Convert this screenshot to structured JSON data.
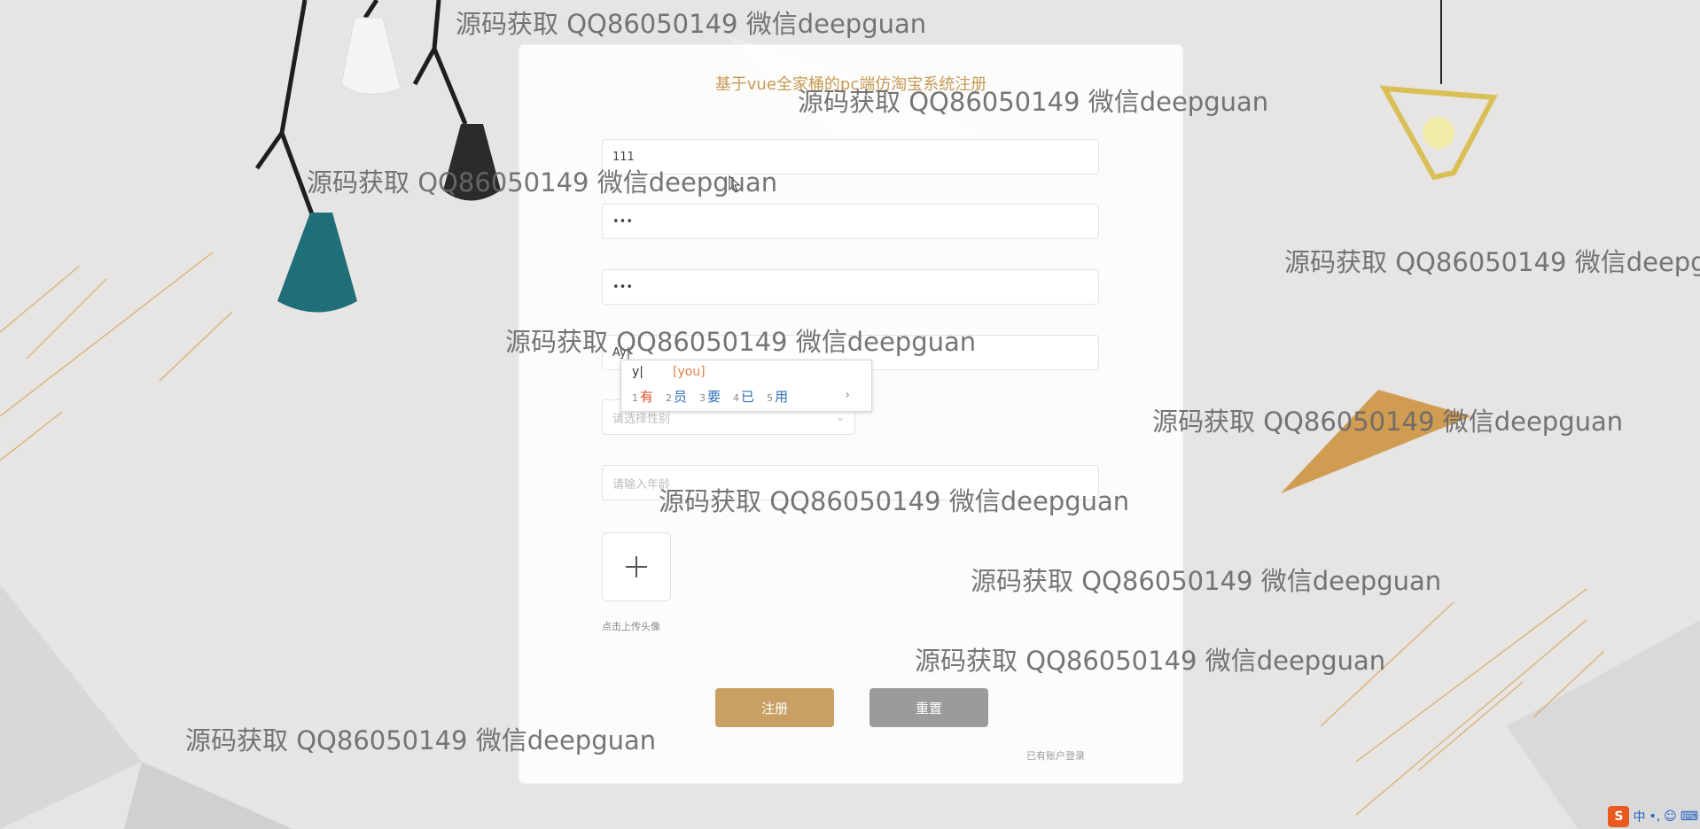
{
  "app": {
    "title": "基于vue全家桶的pc端仿淘宝系统注册"
  },
  "form": {
    "username_value": "111",
    "password_value": "•••",
    "confirm_password_value": "•••",
    "nickname_value": "Ay|",
    "gender_placeholder": "请选择性别",
    "age_placeholder": "请输入年龄",
    "upload_hint": "点击上传头像",
    "register_label": "注册",
    "reset_label": "重置",
    "login_link": "已有账户登录"
  },
  "ime": {
    "composition": "y|",
    "composition_hint": "[you]",
    "candidates": [
      {
        "num": "1",
        "text": "有"
      },
      {
        "num": "2",
        "text": "员"
      },
      {
        "num": "3",
        "text": "要"
      },
      {
        "num": "4",
        "text": "已"
      },
      {
        "num": "5",
        "text": "用"
      }
    ],
    "more": "›"
  },
  "watermark": "源码获取 QQ86050149 微信deepguan",
  "watermark_clipped": "源码获取 QQ86050149 微信deepg",
  "tray": {
    "label1": "中",
    "label2": "•,",
    "label3": "☺",
    "label4": "⌨"
  },
  "colors": {
    "accent": "#c8a063",
    "title": "#c79a55",
    "reset": "#9b9b9b"
  }
}
